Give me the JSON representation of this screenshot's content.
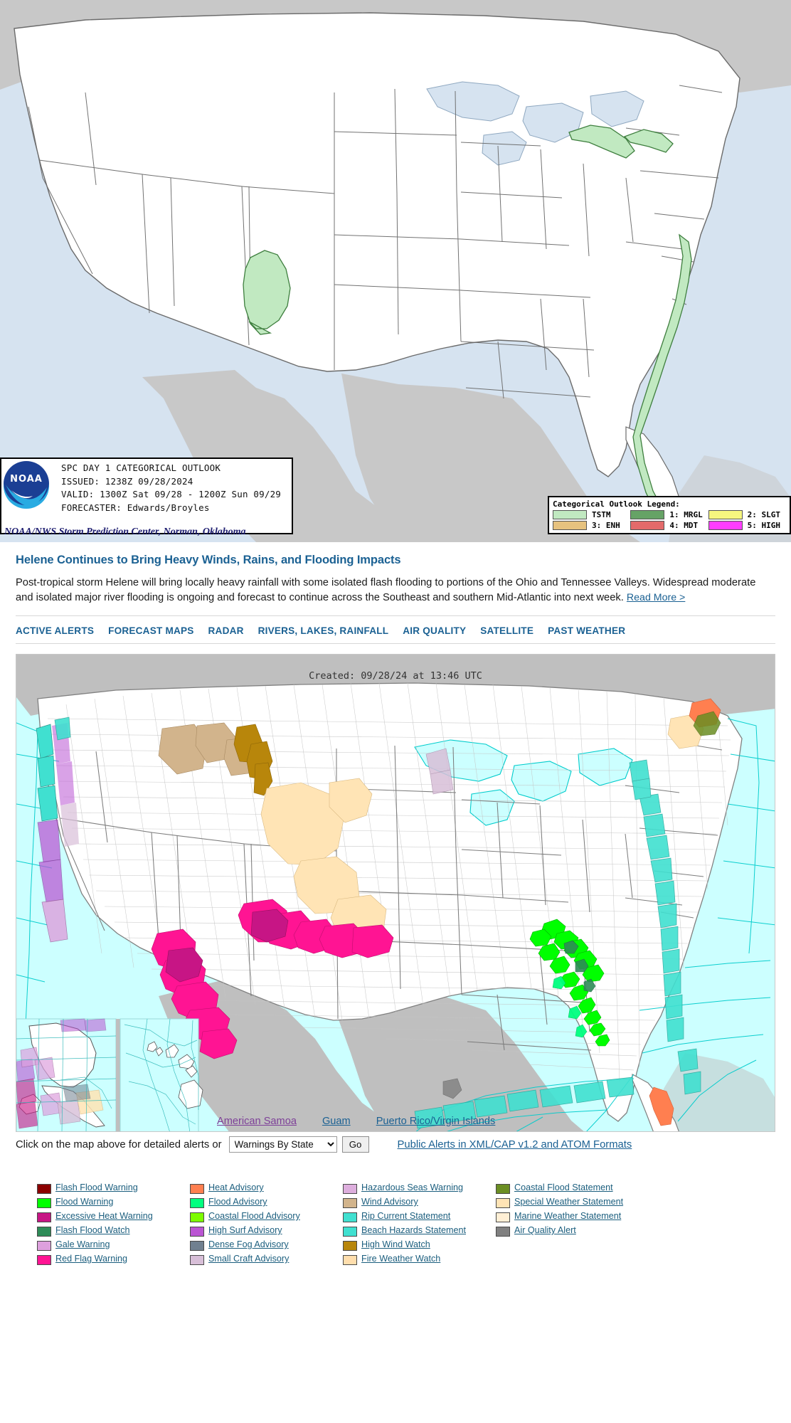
{
  "spc_outlook": {
    "info_box": {
      "line1": "SPC DAY 1 CATEGORICAL OUTLOOK",
      "line2": "ISSUED: 1238Z 09/28/2024",
      "line3": "VALID: 1300Z Sat 09/28 - 1200Z Sun 09/29",
      "line4": "FORECASTER: Edwards/Broyles",
      "logo_text": "NOAA",
      "footer": "NOAA/NWS Storm Prediction Center, Norman, Oklahoma"
    },
    "legend": {
      "title": "Categorical Outlook Legend:",
      "items": [
        {
          "label": "TSTM",
          "color": "#c1e9c1"
        },
        {
          "label": "1: MRGL",
          "color": "#66a366"
        },
        {
          "label": "2: SLGT",
          "color": "#f6f67f"
        },
        {
          "label": "3: ENH",
          "color": "#e6c27f"
        },
        {
          "label": "4: MDT",
          "color": "#e36a6a"
        },
        {
          "label": "5: HIGH",
          "color": "#ff3dff"
        }
      ]
    },
    "map_colors": {
      "ocean": "#d6e3f0",
      "land_outside": "#c8c8c8",
      "land_us": "#ffffff",
      "border": "#6b6b6b",
      "tstm_fill": "#c1e9c1",
      "tstm_stroke": "#3f7f3f"
    }
  },
  "headline": {
    "title": "Helene Continues to Bring Heavy Winds, Rains, and Flooding Impacts",
    "body": "Post-tropical storm Helene will bring locally heavy rainfall with some isolated flash flooding to portions of the Ohio and Tennessee Valleys. Widespread moderate and isolated major river flooding is ongoing and forecast to continue across the Southeast and southern Mid-Atlantic into next week.",
    "read_more": "Read More >"
  },
  "tabs": [
    {
      "label": "ACTIVE ALERTS"
    },
    {
      "label": "FORECAST MAPS"
    },
    {
      "label": "RADAR"
    },
    {
      "label": "RIVERS, LAKES, RAINFALL"
    },
    {
      "label": "AIR QUALITY"
    },
    {
      "label": "SATELLITE"
    },
    {
      "label": "PAST WEATHER"
    }
  ],
  "alerts_map": {
    "created": "Created: 09/28/24 at 13:46 UTC",
    "territory_links": [
      {
        "label": "American Samoa",
        "visited": true
      },
      {
        "label": "Guam",
        "visited": false
      },
      {
        "label": "Puerto Rico/Virgin Islands",
        "visited": false
      }
    ],
    "map_colors": {
      "marine": "#ccffff",
      "marine_grid": "#00cccc",
      "land_outside": "#bfbfbf",
      "county_fill": "#ffffff",
      "county_line": "#b9b9b9",
      "state_line": "#808080"
    }
  },
  "controls": {
    "label": "Click on the map above for detailed alerts or",
    "select_value": "Warnings By State",
    "select_options": [
      "Warnings By State"
    ],
    "go_label": "Go",
    "xml_link": "Public Alerts in XML/CAP v1.2 and ATOM Formats"
  },
  "alert_legend": {
    "columns": [
      [
        {
          "label": "Flash Flood Warning",
          "color": "#8b0000"
        },
        {
          "label": "Flood Warning",
          "color": "#00ff00"
        },
        {
          "label": "Excessive Heat Warning",
          "color": "#c71585"
        },
        {
          "label": "Flash Flood Watch",
          "color": "#2e8b57"
        },
        {
          "label": "Gale Warning",
          "color": "#dda0dd"
        },
        {
          "label": "Red Flag Warning",
          "color": "#ff1493"
        }
      ],
      [
        {
          "label": "Heat Advisory",
          "color": "#ff7f50"
        },
        {
          "label": "Flood Advisory",
          "color": "#00ff7f"
        },
        {
          "label": "Coastal Flood Advisory",
          "color": "#7cfc00"
        },
        {
          "label": "High Surf Advisory",
          "color": "#ba55d3"
        },
        {
          "label": "Dense Fog Advisory",
          "color": "#708090"
        },
        {
          "label": "Small Craft Advisory",
          "color": "#d8bfd8"
        }
      ],
      [
        {
          "label": "Hazardous Seas Warning",
          "color": "#ddaedd"
        },
        {
          "label": "Wind Advisory",
          "color": "#d2b48c"
        },
        {
          "label": "Rip Current Statement",
          "color": "#40e0d0"
        },
        {
          "label": "Beach Hazards Statement",
          "color": "#40e0d0"
        },
        {
          "label": "High Wind Watch",
          "color": "#b8860b"
        },
        {
          "label": "Fire Weather Watch",
          "color": "#ffdead"
        }
      ],
      [
        {
          "label": "Coastal Flood Statement",
          "color": "#6b8e23"
        },
        {
          "label": "Special Weather Statement",
          "color": "#ffe4b5"
        },
        {
          "label": "Marine Weather Statement",
          "color": "#ffefd5"
        },
        {
          "label": "Air Quality Alert",
          "color": "#808080"
        }
      ]
    ]
  }
}
